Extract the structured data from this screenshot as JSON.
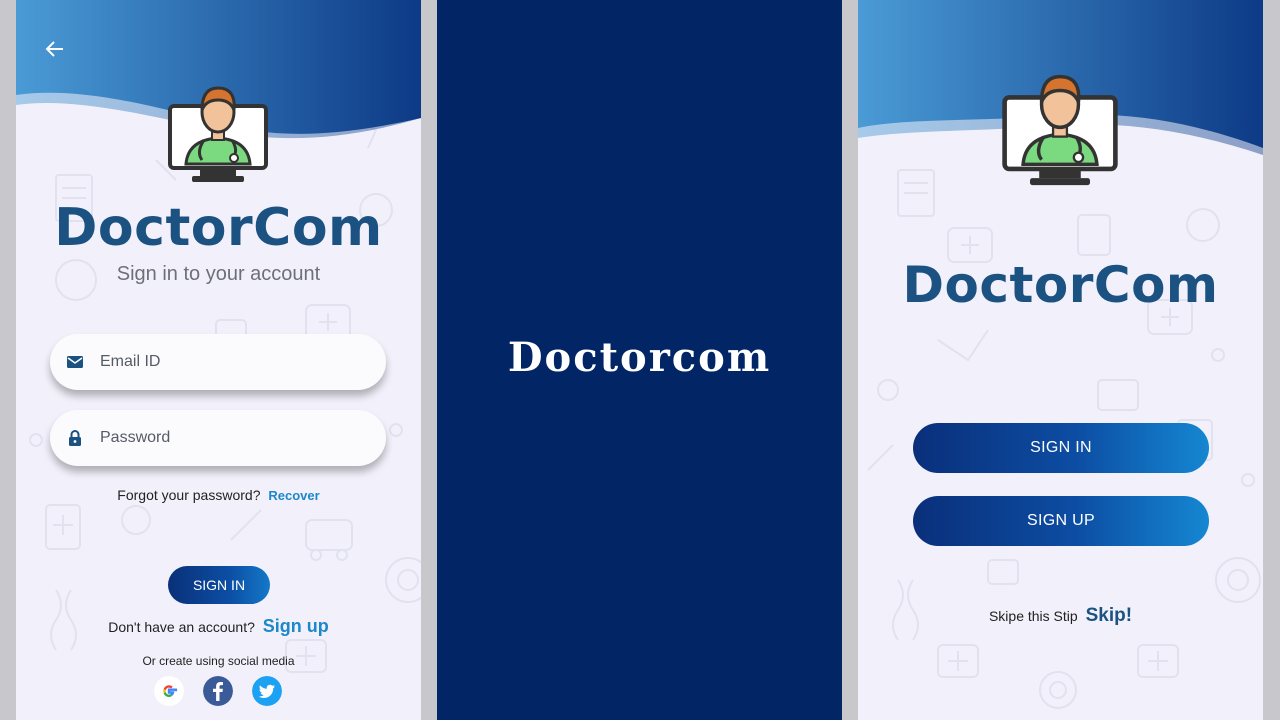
{
  "signin_screen": {
    "brand": "DoctorCom",
    "subtitle": "Sign in to your account",
    "email_placeholder": "Email ID",
    "password_placeholder": "Password",
    "forgot_text": "Forgot your password?",
    "recover_link": "Recover",
    "signin_button": "SIGN IN",
    "no_account_text": "Don't have an account?",
    "signup_link": "Sign up",
    "social_text": "Or create using social media",
    "social_icons": [
      "google-icon",
      "facebook-icon",
      "twitter-icon"
    ]
  },
  "splash_screen": {
    "logo_text": "Doctorcom"
  },
  "welcome_screen": {
    "brand": "DoctorCom",
    "signin_button": "SIGN IN",
    "signup_button": "SIGN UP",
    "skip_text": "Skipe this Stip",
    "skip_link": "Skip!"
  },
  "colors": {
    "brand": "#1c5281",
    "splash_bg": "#022566",
    "link": "#1c88c9",
    "button_start": "#0a2f7a",
    "button_end": "#1587d2"
  }
}
